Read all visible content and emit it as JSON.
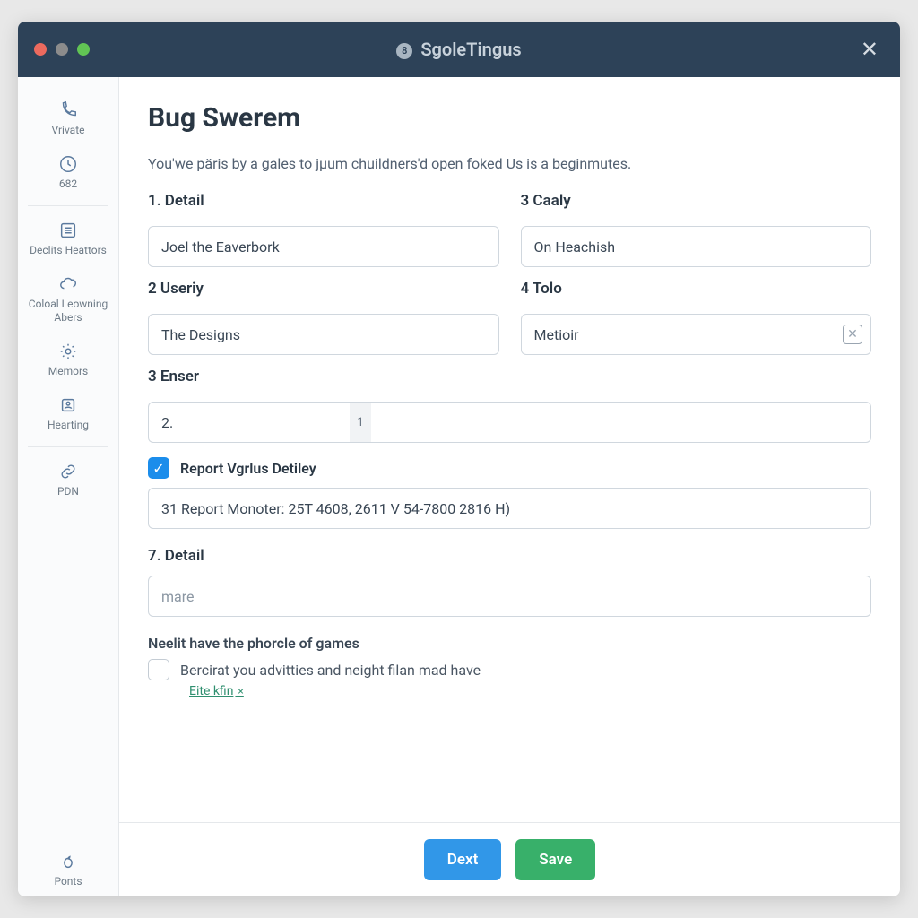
{
  "titlebar": {
    "app_name": "SgoleTingus",
    "badge": "8"
  },
  "sidebar": {
    "items": [
      {
        "label": "Vrivate"
      },
      {
        "label": "682"
      },
      {
        "label": "Declits Heattors"
      },
      {
        "label": "Coloal Leowning Abers"
      },
      {
        "label": "Memors"
      },
      {
        "label": "Hearting"
      },
      {
        "label": "PDN"
      }
    ],
    "bottom_label": "Ponts"
  },
  "page": {
    "title": "Bug Swerem",
    "intro": "You'we päris by a gales to jµum chuildners'd open foked Us is a beginmutes."
  },
  "form": {
    "f1": {
      "label": "1. Detail",
      "value": "Joel the Eaverbork"
    },
    "f3c": {
      "label": "3 Caaly",
      "value": "On Heachish"
    },
    "f2": {
      "label": "2 Useriy",
      "value": "The Designs"
    },
    "f4": {
      "label": "4 Tolo",
      "value": "Metioir"
    },
    "f3e": {
      "label": "3 Enser",
      "seg_a": "2.",
      "seg_sep": "1"
    },
    "report_check_label": "Report Vgrlus Detiley",
    "report_value": "31 Report Monoter: 25T 4608, 2611 V 54-7800 2816 H)",
    "f7": {
      "label": "7. Detail",
      "placeholder": "mare"
    },
    "section_sub": "Neelit have the phorcle of games",
    "agree_label": "Bercirat you advitties and neight filan mad have",
    "link_label": "Eite kfin"
  },
  "footer": {
    "next": "Dext",
    "save": "Save"
  }
}
